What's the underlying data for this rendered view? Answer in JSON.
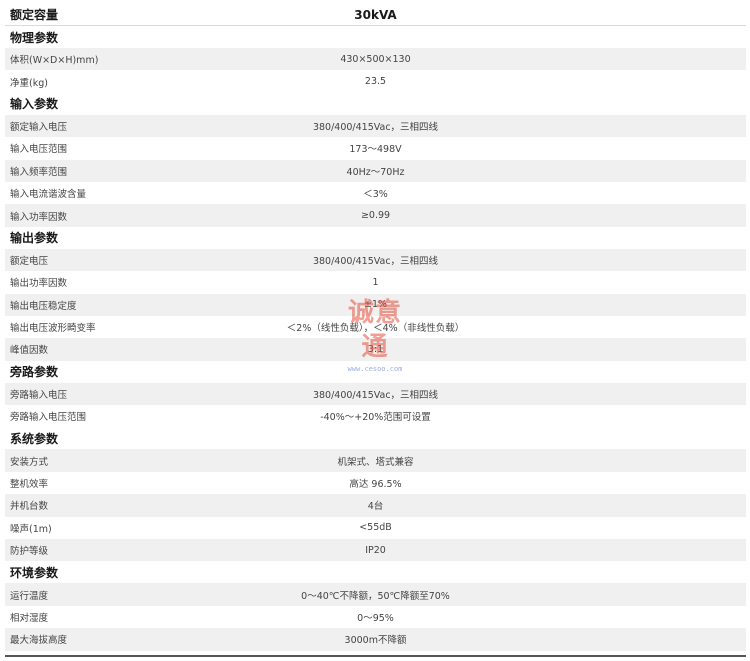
{
  "header": {
    "label": "额定容量",
    "value": "30kVA"
  },
  "sections": [
    {
      "title": "物理参数",
      "rows": [
        {
          "label": "体积(W×D×H)mm)",
          "value": "430×500×130"
        },
        {
          "label": "净重(kg)",
          "value": "23.5"
        }
      ]
    },
    {
      "title": "输入参数",
      "rows": [
        {
          "label": "额定输入电压",
          "value": "380/400/415Vac，三相四线"
        },
        {
          "label": "输入电压范围",
          "value": "173～498V"
        },
        {
          "label": "输入频率范围",
          "value": "40Hz～70Hz"
        },
        {
          "label": "输入电流谐波含量",
          "value": "＜3%"
        },
        {
          "label": "输入功率因数",
          "value": "≥0.99"
        }
      ]
    },
    {
      "title": "输出参数",
      "rows": [
        {
          "label": "额定电压",
          "value": "380/400/415Vac，三相四线"
        },
        {
          "label": "输出功率因数",
          "value": "1"
        },
        {
          "label": "输出电压稳定度",
          "value": "±1%"
        },
        {
          "label": "输出电压波形畸变率",
          "value": "＜2%（线性负载），＜4%（非线性负载）"
        },
        {
          "label": "峰值因数",
          "value": "3:1"
        }
      ]
    },
    {
      "title": "旁路参数",
      "rows": [
        {
          "label": "旁路输入电压",
          "value": "380/400/415Vac，三相四线"
        },
        {
          "label": "旁路输入电压范围",
          "value": "-40%～+20%范围可设置"
        }
      ]
    },
    {
      "title": "系统参数",
      "rows": [
        {
          "label": "安装方式",
          "value": "机架式、塔式兼容"
        },
        {
          "label": "整机效率",
          "value": "高达 96.5%"
        },
        {
          "label": "并机台数",
          "value": "4台"
        },
        {
          "label": "噪声(1m)",
          "value": "<55dB"
        },
        {
          "label": "防护等级",
          "value": "IP20"
        }
      ]
    },
    {
      "title": "环境参数",
      "rows": [
        {
          "label": "运行温度",
          "value": "0～40℃不降额，50℃降额至70%"
        },
        {
          "label": "相对湿度",
          "value": "0～95%"
        },
        {
          "label": "最大海拔高度",
          "value": "3000m不降额"
        }
      ]
    }
  ],
  "watermark": {
    "title": "诚意通",
    "subtitle": "www.cesoo.com"
  }
}
